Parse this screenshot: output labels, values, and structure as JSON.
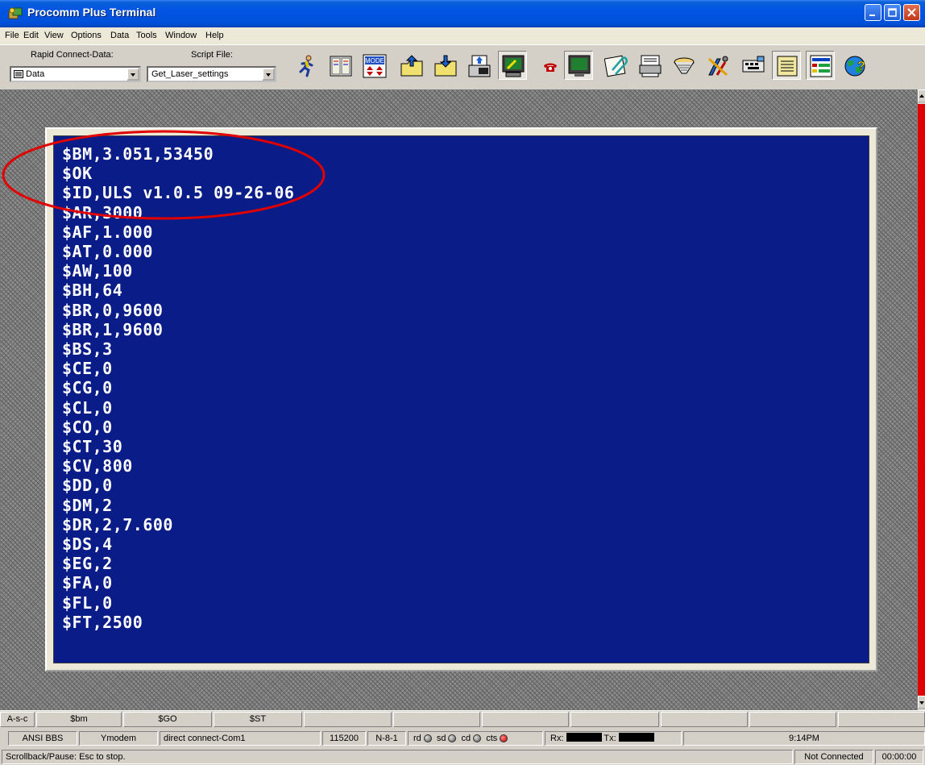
{
  "window": {
    "title": "Procomm Plus Terminal"
  },
  "menu": [
    "File",
    "Edit",
    "View",
    "Options",
    "Data",
    "Tools",
    "Window",
    "Help"
  ],
  "toolbar": {
    "rapid_connect_label": "Rapid Connect-Data:",
    "rapid_connect_value": "Data",
    "script_file_label": "Script File:",
    "script_file_value": "Get_Laser_settings"
  },
  "terminal": {
    "lines": [
      "$BM,3.051,53450",
      "$OK",
      "$ID,ULS v1.0.5 09-26-06",
      "$AR,3000",
      "$AF,1.000",
      "$AT,0.000",
      "$AW,100",
      "$BH,64",
      "$BR,0,9600",
      "$BR,1,9600",
      "$BS,3",
      "$CE,0",
      "$CG,0",
      "$CL,0",
      "$CO,0",
      "$CT,30",
      "$CV,800",
      "$DD,0",
      "$DM,2",
      "$DR,2,7.600",
      "$DS,4",
      "$EG,2",
      "$FA,0",
      "$FL,0",
      "$FT,2500"
    ],
    "background_color": "#0a1c87",
    "text_color": "#ffffff",
    "highlight_color": "#e00000"
  },
  "function_keys": [
    "A-s-c",
    "$bm",
    "$GO",
    "$ST",
    "",
    "",
    "",
    "",
    "",
    "",
    ""
  ],
  "status_bar": {
    "emulation": "ANSI BBS",
    "protocol": "Ymodem",
    "connection": "direct connect-Com1",
    "baud": "115200",
    "parity": "N-8-1",
    "leds": [
      {
        "label": "rd",
        "on": false
      },
      {
        "label": "sd",
        "on": false
      },
      {
        "label": "cd",
        "on": false
      },
      {
        "label": "cts",
        "on": true
      }
    ],
    "rx_label": "Rx:",
    "tx_label": "Tx:",
    "time": "9:14PM",
    "message": "Scrollback/Pause: Esc to stop.",
    "connection_state": "Not Connected",
    "elapsed": "00:00:00"
  }
}
